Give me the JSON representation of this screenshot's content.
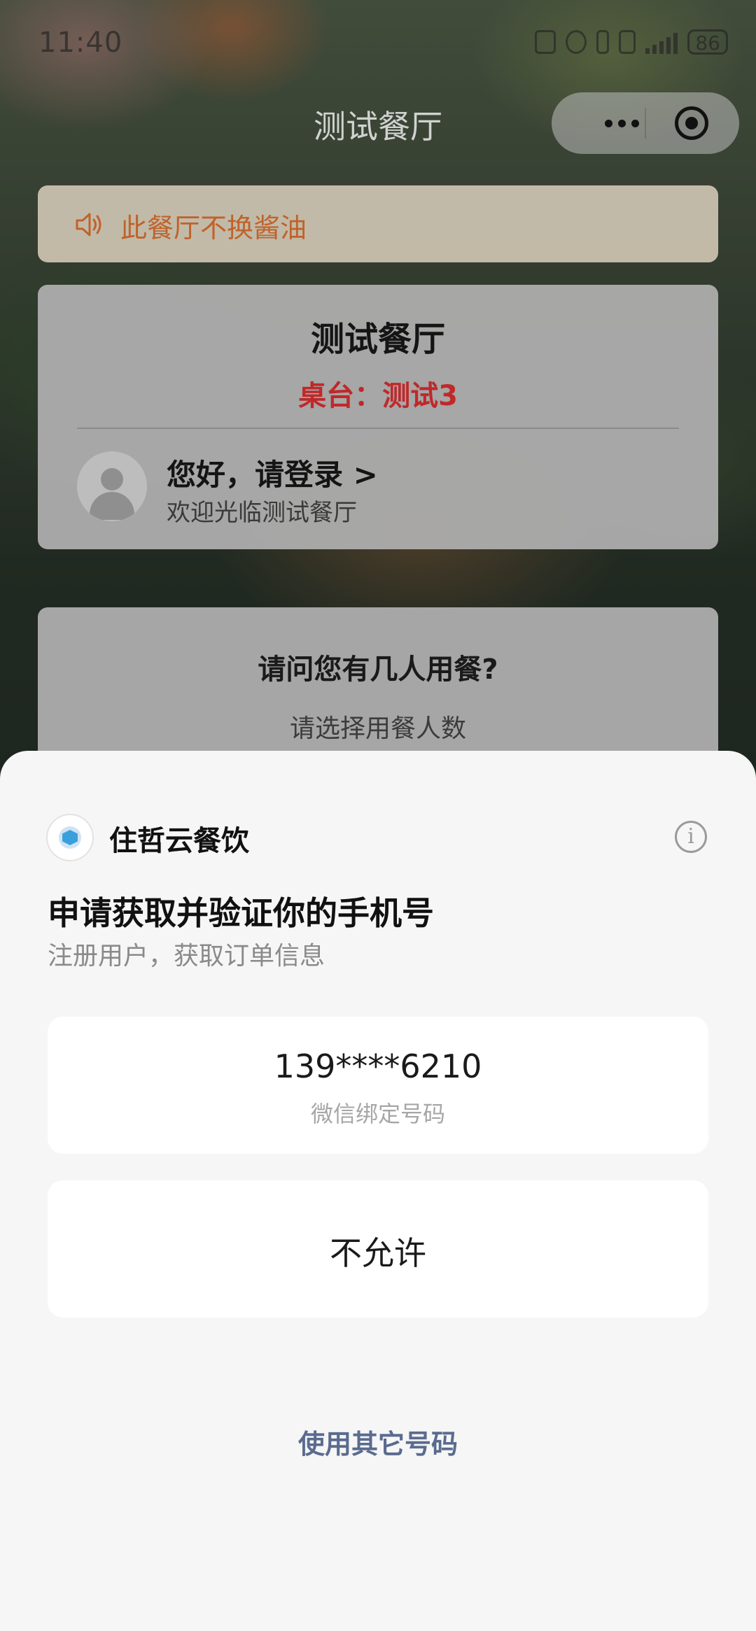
{
  "status_bar": {
    "time": "11:40",
    "battery": "86"
  },
  "header": {
    "title": "测试餐厅"
  },
  "notice": {
    "text": "此餐厅不换酱油"
  },
  "restaurant_card": {
    "name": "测试餐厅",
    "table": "桌台：测试3",
    "login_title": "您好，请登录 >",
    "welcome": "欢迎光临测试餐厅"
  },
  "diners_card": {
    "question": "请问您有几人用餐?",
    "hint": "请选择用餐人数"
  },
  "auth_sheet": {
    "app_name": "住哲云餐饮",
    "info_icon_glyph": "i",
    "title": "申请获取并验证你的手机号",
    "subtitle": "注册用户，获取订单信息",
    "phone_number": "139****6210",
    "phone_label": "微信绑定号码",
    "deny_label": "不允许",
    "other_number_link": "使用其它号码"
  },
  "colors": {
    "notice_text": "#c0622a",
    "table_label": "#c0282a",
    "link": "#5b6b8f",
    "sheet_bg": "#f6f6f6"
  },
  "icons": [
    "speaker-icon",
    "user-avatar-icon",
    "app-logo-icon",
    "info-icon",
    "more-icon",
    "close-miniprogram-icon"
  ]
}
